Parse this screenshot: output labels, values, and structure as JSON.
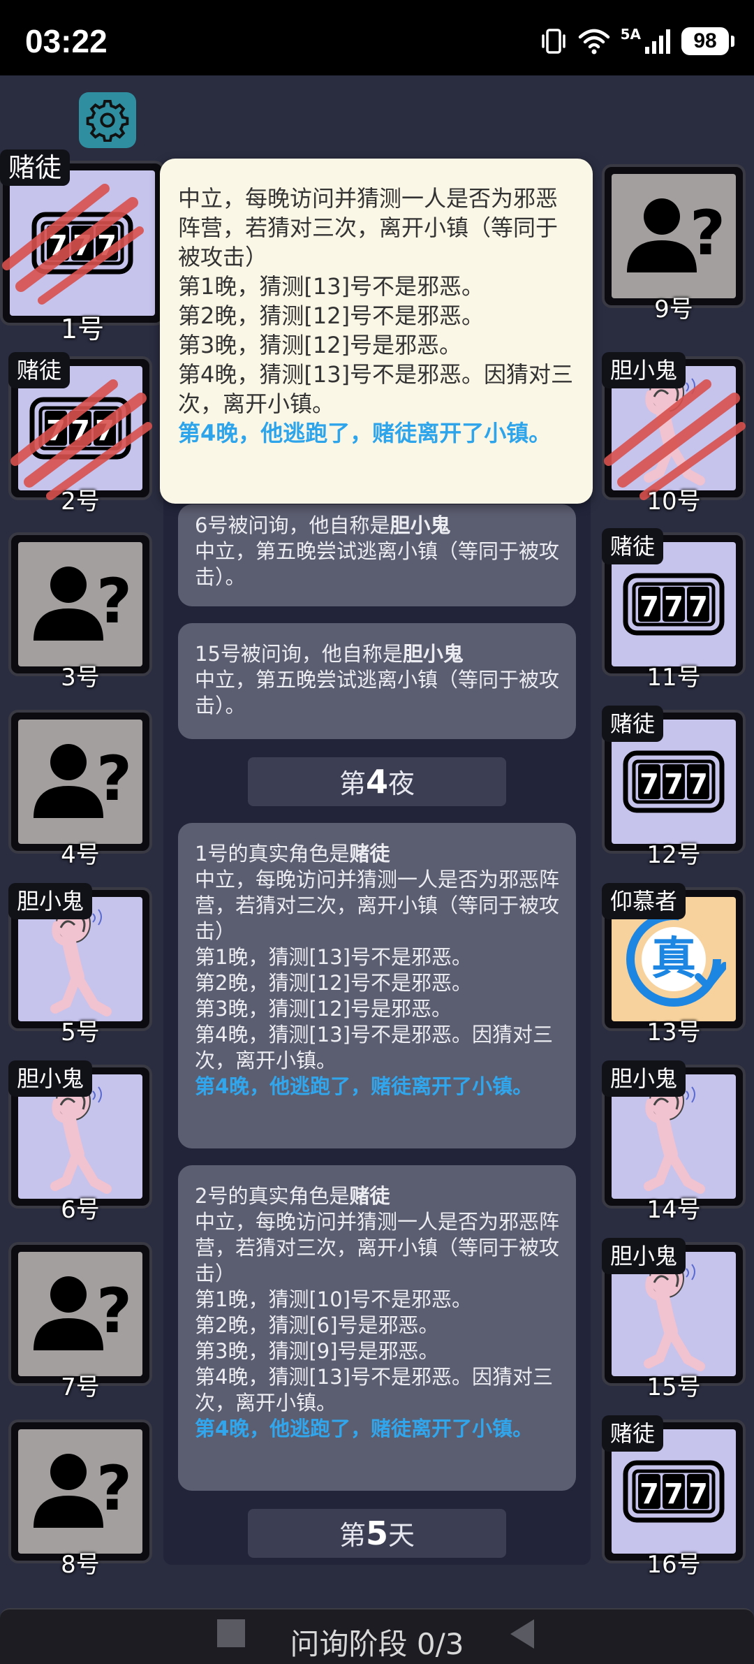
{
  "status": {
    "time": "03:22",
    "network": "5A",
    "battery": "98"
  },
  "settings": {
    "icon": "gear-icon"
  },
  "players": [
    {
      "n": "1号",
      "role": "赌徒",
      "type": "gambler",
      "dead": true
    },
    {
      "n": "2号",
      "role": "赌徒",
      "type": "gambler",
      "dead": true
    },
    {
      "n": "3号",
      "role": "",
      "type": "unknown",
      "dead": false
    },
    {
      "n": "4号",
      "role": "",
      "type": "unknown",
      "dead": false
    },
    {
      "n": "5号",
      "role": "胆小鬼",
      "type": "coward",
      "dead": false
    },
    {
      "n": "6号",
      "role": "胆小鬼",
      "type": "coward",
      "dead": false
    },
    {
      "n": "7号",
      "role": "",
      "type": "unknown",
      "dead": false
    },
    {
      "n": "8号",
      "role": "",
      "type": "unknown",
      "dead": false
    },
    {
      "n": "9号",
      "role": "",
      "type": "unknown",
      "dead": false
    },
    {
      "n": "10号",
      "role": "胆小鬼",
      "type": "coward",
      "dead": true
    },
    {
      "n": "11号",
      "role": "赌徒",
      "type": "gambler",
      "dead": false
    },
    {
      "n": "12号",
      "role": "赌徒",
      "type": "gambler",
      "dead": false
    },
    {
      "n": "13号",
      "role": "仰慕者",
      "type": "admirer",
      "dead": false,
      "badge": "真"
    },
    {
      "n": "14号",
      "role": "胆小鬼",
      "type": "coward",
      "dead": false
    },
    {
      "n": "15号",
      "role": "胆小鬼",
      "type": "coward",
      "dead": false
    },
    {
      "n": "16号",
      "role": "赌徒",
      "type": "gambler",
      "dead": false
    }
  ],
  "popover": {
    "lines": [
      "中立，每晚访问并猜测一人是否为邪恶阵营，若猜对三次，离开小镇（等同于被攻击）",
      "第1晚，猜测[13]号不是邪恶。",
      "第2晚，猜测[12]号不是邪恶。",
      "第3晚，猜测[12]号是邪恶。",
      "第4晚，猜测[13]号不是邪恶。因猜对三次，离开小镇。"
    ],
    "highlight": "第4晚，他逃跑了，赌徒离开了小镇。"
  },
  "log": {
    "msg6": {
      "prefix": "6号被问询，他自称是",
      "role": "胆小鬼",
      "body": "中立，第五晚尝试逃离小镇（等同于被攻击）。"
    },
    "msg15": {
      "prefix": "15号被问询，他自称是",
      "role": "胆小鬼",
      "body": "中立，第五晚尝试逃离小镇（等同于被攻击）。"
    },
    "night4": {
      "pre": "第",
      "num": "4",
      "post": "夜"
    },
    "reveal1": {
      "prefix": "1号的真实角色是",
      "role": "赌徒",
      "lines": [
        "中立，每晚访问并猜测一人是否为邪恶阵营，若猜对三次，离开小镇（等同于被攻击）",
        "第1晚，猜测[13]号不是邪恶。",
        "第2晚，猜测[12]号不是邪恶。",
        "第3晚，猜测[12]号是邪恶。",
        "第4晚，猜测[13]号不是邪恶。因猜对三次，离开小镇。"
      ],
      "highlight": "第4晚，他逃跑了，赌徒离开了小镇。"
    },
    "reveal2": {
      "prefix": "2号的真实角色是",
      "role": "赌徒",
      "lines": [
        "中立，每晚访问并猜测一人是否为邪恶阵营，若猜对三次，离开小镇（等同于被攻击）",
        "第1晚，猜测[10]号不是邪恶。",
        "第2晚，猜测[6]号是邪恶。",
        "第3晚，猜测[9]号是邪恶。",
        "第4晚，猜测[13]号不是邪恶。因猜对三次，离开小镇。"
      ],
      "highlight": "第4晚，他逃跑了，赌徒离开了小镇。"
    },
    "day5": {
      "pre": "第",
      "num": "5",
      "post": "天"
    }
  },
  "bottom": {
    "phase": "问询阶段 0/3"
  }
}
